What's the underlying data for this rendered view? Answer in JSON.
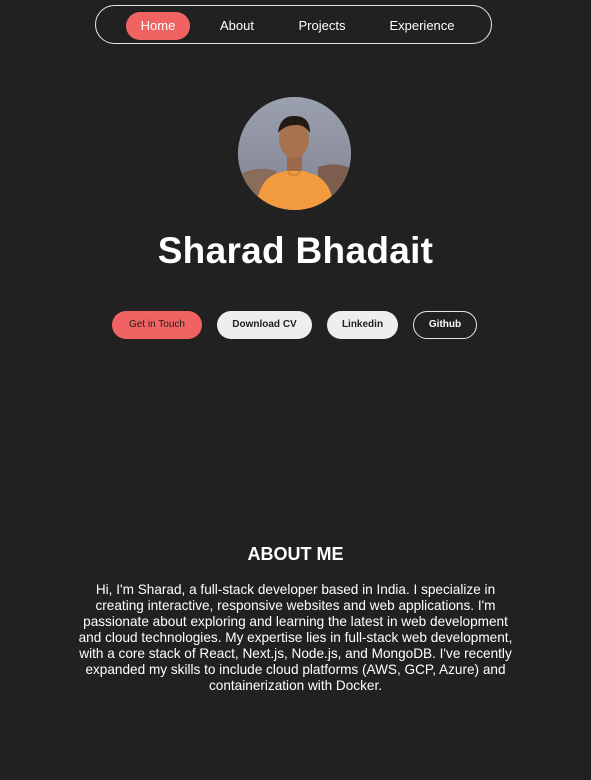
{
  "nav": {
    "items": [
      {
        "label": "Home",
        "active": true
      },
      {
        "label": "About",
        "active": false
      },
      {
        "label": "Projects",
        "active": false
      },
      {
        "label": "Experience",
        "active": false
      }
    ]
  },
  "hero": {
    "name": "Sharad Bhadait",
    "buttons": {
      "contact": "Get in Touch",
      "cv": "Download CV",
      "linkedin": "Linkedin",
      "github": "Github"
    }
  },
  "about": {
    "title": "ABOUT ME",
    "text": "Hi, I'm Sharad, a full-stack developer based in India. I specialize in creating interactive, responsive websites and web applications. I'm passionate about exploring and learning the latest in web development and cloud technologies. My expertise lies in full-stack web development, with a core stack of React, Next.js, Node.js, and MongoDB. I've recently expanded my skills to include cloud platforms (AWS, GCP, Azure) and containerization with Docker."
  },
  "colors": {
    "background": "#212121",
    "accent": "#f16362",
    "light_button": "#eeeeee"
  }
}
